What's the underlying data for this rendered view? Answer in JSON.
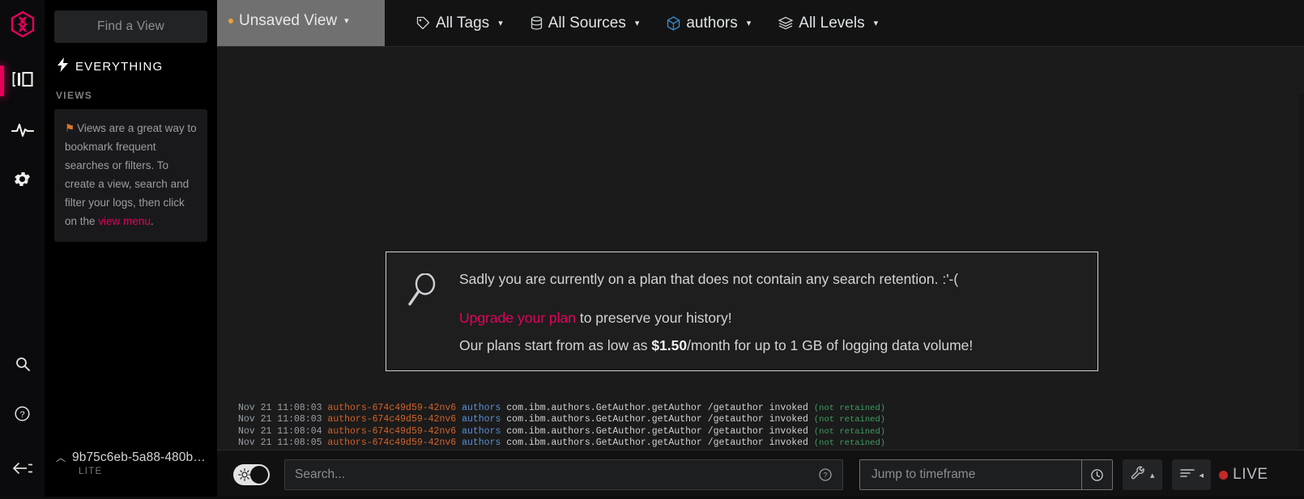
{
  "brand": {
    "logo_icon": "dna-hexagon-logo",
    "accent": "#e6005c"
  },
  "rail": {
    "items": [
      {
        "icon": "logs-panel-icon",
        "name": "logs",
        "active": true
      },
      {
        "icon": "activity-pulse-icon",
        "name": "livetail",
        "active": false
      },
      {
        "icon": "gear-icon",
        "name": "settings",
        "active": false
      },
      {
        "icon": "search-icon",
        "name": "search",
        "active": false
      },
      {
        "icon": "question-circle-icon",
        "name": "help",
        "active": false
      },
      {
        "icon": "collapse-arrow-icon",
        "name": "collapse",
        "active": false
      }
    ]
  },
  "sidebar": {
    "find_view_placeholder": "Find a View",
    "everything_label": "EVERYTHING",
    "everything_icon": "lightning-bolt-icon",
    "views_header": "VIEWS",
    "views_card": {
      "flag_icon": "flag-icon",
      "text_before": "Views are a great way to bookmark frequent searches or filters. To create a view, search and filter your logs, then click on the ",
      "link_text": "view menu",
      "text_after": "."
    },
    "account": {
      "caret_icon": "chevron-up-icon",
      "id": "9b75c6eb-5a88-480b…",
      "plan": "LITE"
    }
  },
  "topbar": {
    "view_tab": {
      "label": "Unsaved View",
      "dot_color": "#e8a33d",
      "caret": "▾"
    },
    "filters": [
      {
        "icon": "tag-icon",
        "label": "All Tags",
        "caret": "▾"
      },
      {
        "icon": "database-icon",
        "label": "All Sources",
        "caret": "▾"
      },
      {
        "icon": "cube-icon",
        "label": "authors",
        "caret": "▾"
      },
      {
        "icon": "layers-icon",
        "label": "All Levels",
        "caret": "▾"
      }
    ]
  },
  "retention_notice": {
    "icon": "magnifier-icon",
    "line1": "Sadly you are currently on a plan that does not contain any search retention. :'-(",
    "link": "Upgrade your plan",
    "line2_rest": " to preserve your history!",
    "line3_pre": "Our plans start from as low as ",
    "line3_price": "$1.50",
    "line3_post": "/month for up to 1 GB of logging data volume!"
  },
  "logs": [
    {
      "ts": "Nov 21 11:08:03",
      "host": "authors-674c49d59-42nv6",
      "app": "authors",
      "msg": "com.ibm.authors.GetAuthor.getAuthor /getauthor invoked",
      "tag": "(not retained)"
    },
    {
      "ts": "Nov 21 11:08:03",
      "host": "authors-674c49d59-42nv6",
      "app": "authors",
      "msg": "com.ibm.authors.GetAuthor.getAuthor /getauthor invoked",
      "tag": "(not retained)"
    },
    {
      "ts": "Nov 21 11:08:04",
      "host": "authors-674c49d59-42nv6",
      "app": "authors",
      "msg": "com.ibm.authors.GetAuthor.getAuthor /getauthor invoked",
      "tag": "(not retained)"
    },
    {
      "ts": "Nov 21 11:08:05",
      "host": "authors-674c49d59-42nv6",
      "app": "authors",
      "msg": "com.ibm.authors.GetAuthor.getAuthor /getauthor invoked",
      "tag": "(not retained)"
    }
  ],
  "bottombar": {
    "theme_toggle_icon": "sun-icon",
    "search_placeholder": "Search...",
    "search_value": "",
    "help_icon": "question-circle-icon",
    "timeframe_placeholder": "Jump to timeframe",
    "timeframe_value": "",
    "clock_icon": "clock-icon",
    "tools_icon": "wrench-icon",
    "tools_caret": "▴",
    "lines_icon": "lines-icon",
    "lines_caret": "◂",
    "live_label": "LIVE",
    "live_dot_color": "#c62828"
  }
}
